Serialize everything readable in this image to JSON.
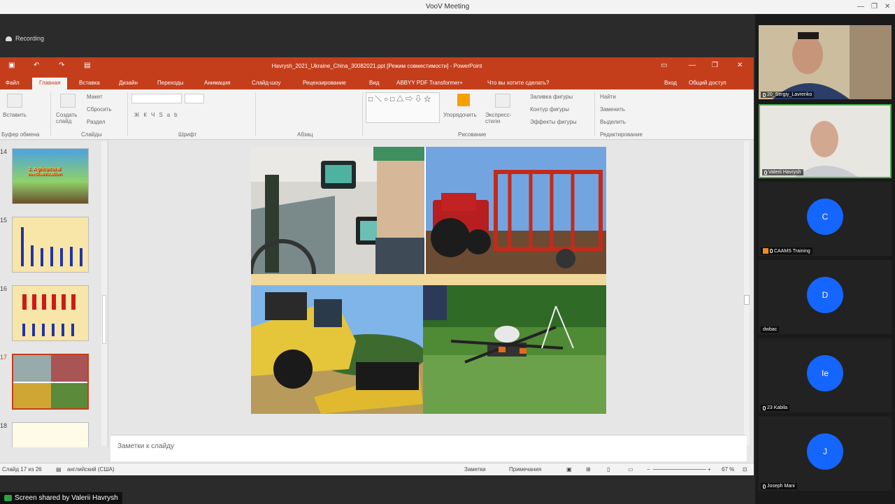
{
  "window": {
    "title": "VooV Meeting"
  },
  "recording": {
    "label": "Recording"
  },
  "ppt": {
    "title": "Havrysh_2021_Ukraine_China_30082021.ppt [Режим совместимости] - PowerPoint",
    "tabs": [
      "Файл",
      "Главная",
      "Вставка",
      "Дизайн",
      "Переходы",
      "Анимация",
      "Слайд-шоу",
      "Рецензирование",
      "Вид",
      "ABBYY PDF Transformer+",
      "Что вы хотите сделать?"
    ],
    "signin": "Вход",
    "share": "Общий доступ",
    "ribbon": {
      "paste": "Вставить",
      "create_slide": "Создать слайд",
      "layout": "Макет",
      "reset": "Сбросить",
      "section": "Раздел",
      "clipboard_group": "Буфер обмена",
      "slides_group": "Слайды",
      "font_group": "Шрифт",
      "paragraph_group": "Абзац",
      "drawing_group": "Рисование",
      "editing_group": "Редактирование",
      "arrange": "Упорядочить",
      "quick_styles": "Экспресс-стили",
      "shape_fill": "Заливка фигуры",
      "shape_outline": "Контур фигуры",
      "shape_effects": "Эффекты фигуры",
      "find": "Найти",
      "replace": "Заменить",
      "select": "Выделить"
    },
    "thumbs": [
      {
        "num": "14",
        "title": "3. Agricultural mechanization"
      },
      {
        "num": "15",
        "title": ""
      },
      {
        "num": "16",
        "title": ""
      },
      {
        "num": "17",
        "title": ""
      },
      {
        "num": "18",
        "title": ""
      }
    ],
    "notes_placeholder": "Заметки к слайду",
    "status": {
      "slide": "Слайд 17 из 26",
      "lang": "английский (США)",
      "notes": "Заметки",
      "comments": "Примечания",
      "zoom": "67 %"
    }
  },
  "share_banner": "Screen shared by Valerii Havrysh",
  "participants": [
    {
      "name": "20_Sergiy_Lavrenko",
      "type": "video"
    },
    {
      "name": "Valerii Havrysh",
      "type": "video",
      "active": true
    },
    {
      "name": "CAAMS Training",
      "type": "avatar",
      "initial": "C"
    },
    {
      "name": "dwbac",
      "type": "avatar",
      "initial": "D"
    },
    {
      "name": "23 Kabila",
      "type": "avatar",
      "initial": "Ie"
    },
    {
      "name": "Joseph Mani",
      "type": "avatar",
      "initial": "J"
    }
  ],
  "colors": {
    "ppt_accent": "#c43e1c",
    "avatar_blue": "#1565ff",
    "active_border": "#4caf50"
  }
}
